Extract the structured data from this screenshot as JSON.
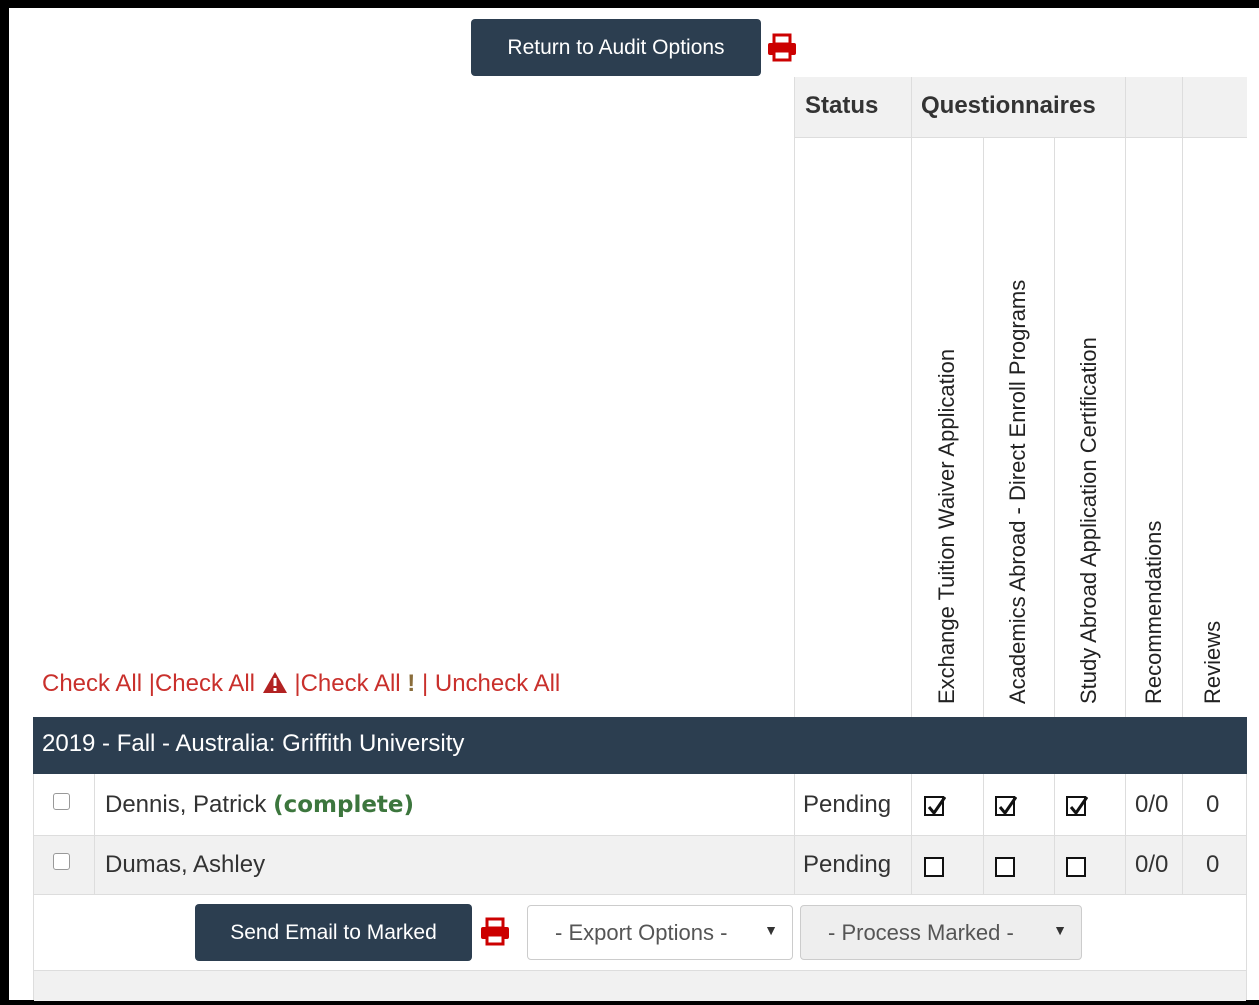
{
  "toolbar": {
    "return_label": "Return to Audit Options"
  },
  "table_header": {
    "status": "Status",
    "questionnaires": "Questionnaires",
    "q1": "Exchange Tuition Waiver Application",
    "q2": "Academics Abroad - Direct Enroll Programs",
    "q3": "Study Abroad Application Certification",
    "recommendations": "Recommendations",
    "reviews": "Reviews"
  },
  "check_links": {
    "check_all": "Check All",
    "check_all_warning": "Check All",
    "check_all_exclaim": "Check All",
    "exclaim_glyph": "!",
    "uncheck_all": "Uncheck All",
    "separator": "|"
  },
  "group": {
    "title": "2019 - Fall - Australia: Griffith University"
  },
  "rows": [
    {
      "name": "Dennis, Patrick",
      "tag": "(complete)",
      "status": "Pending",
      "q1": true,
      "q2": true,
      "q3": true,
      "recommendations": "0/0",
      "reviews": "0"
    },
    {
      "name": "Dumas, Ashley",
      "tag": "",
      "status": "Pending",
      "q1": false,
      "q2": false,
      "q3": false,
      "recommendations": "0/0",
      "reviews": "0"
    }
  ],
  "footer": {
    "send_email_label": "Send Email to Marked",
    "export_options": "- Export Options -",
    "process_marked": "- Process Marked -"
  },
  "colors": {
    "dark_navy": "#2c3e50",
    "link_red": "#c9302c",
    "complete_green": "#3c763d",
    "print_red": "#cc0000"
  }
}
